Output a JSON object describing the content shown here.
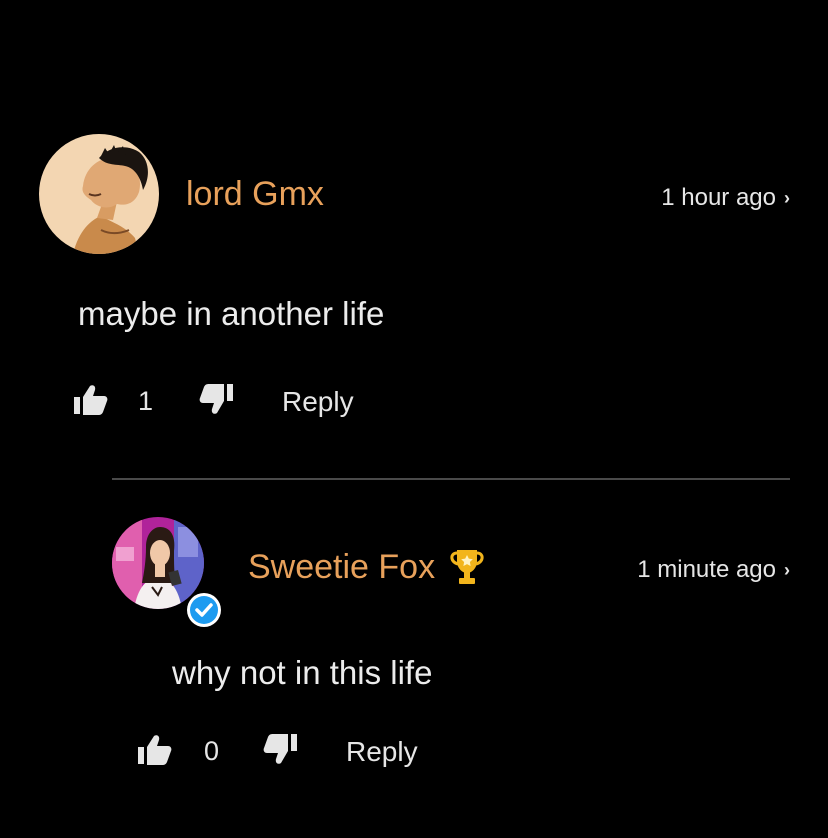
{
  "comments": [
    {
      "username": "lord Gmx",
      "time": "1 hour ago",
      "text": "maybe in another life",
      "likes": "1",
      "reply_label": "Reply",
      "icons": {
        "avatar": "anime-avatar",
        "like": "thumbs-up-icon",
        "dislike": "thumbs-down-icon",
        "more": "chevron-right-icon"
      }
    },
    {
      "username": "Sweetie Fox",
      "time": "1 minute ago",
      "text": "why not in this life",
      "likes": "0",
      "reply_label": "Reply",
      "icons": {
        "avatar": "photo-avatar",
        "badge": "verified-check-icon",
        "award": "trophy-icon",
        "like": "thumbs-up-icon",
        "dislike": "thumbs-down-icon",
        "more": "chevron-right-icon"
      }
    }
  ],
  "colors": {
    "background": "#000000",
    "username": "#e8a15b",
    "verified": "#1d9bf0",
    "trophy": "#f2b51c"
  }
}
